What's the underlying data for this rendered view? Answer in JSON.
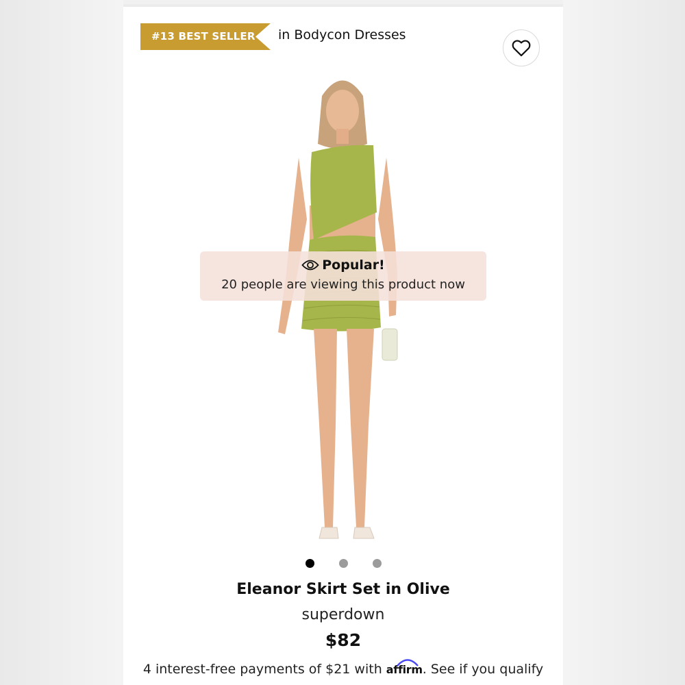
{
  "badge": {
    "label": "#13 BEST SELLER",
    "color": "#c99c32"
  },
  "category": "in Bodycon Dresses",
  "favorite": {
    "icon": "heart-icon"
  },
  "popular": {
    "icon": "eye-icon",
    "title": "Popular!",
    "message": "20 people are viewing this product now"
  },
  "carousel": {
    "count": 3,
    "active_index": 0
  },
  "product": {
    "name": "Eleanor Skirt Set in Olive",
    "brand": "superdown",
    "price": "$82"
  },
  "payment": {
    "prefix": "4 interest-free payments of $21 with",
    "provider": "affirm",
    "suffix": ". See if you qualify"
  },
  "colors": {
    "accent": "#c99c32",
    "popular_bg": "#f5e0da",
    "garment": "#a7b64a"
  }
}
